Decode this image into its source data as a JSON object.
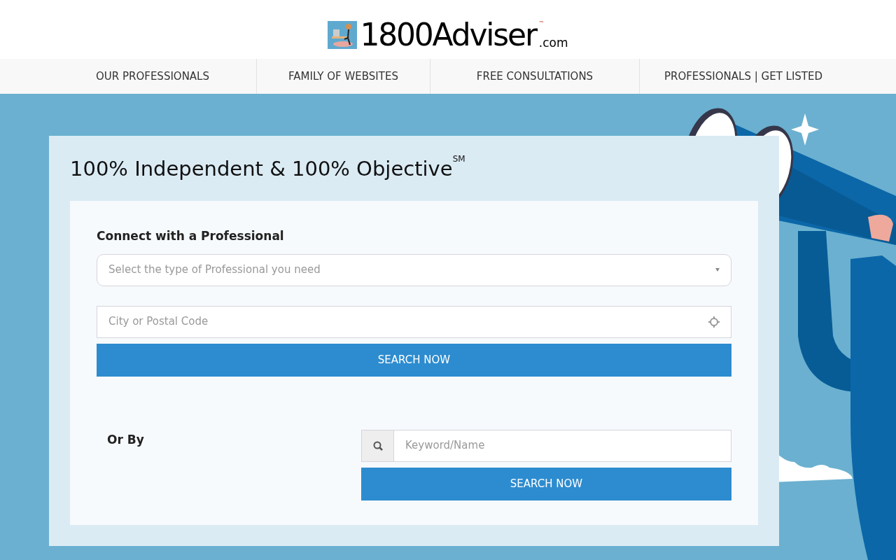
{
  "logo": {
    "name": "1800Adviser",
    "mark": "™",
    "suffix": ".com"
  },
  "nav": [
    {
      "label": "OUR PROFESSIONALS"
    },
    {
      "label": "FAMILY OF WEBSITES"
    },
    {
      "label": "FREE CONSULTATIONS"
    },
    {
      "label": "PROFESSIONALS | GET LISTED"
    }
  ],
  "hero": {
    "title": "100% Independent & 100% Objective$^{SM}$",
    "heading": "Connect with a Professional",
    "type_select": {
      "placeholder": "Select the type of Professional you need"
    },
    "location": {
      "placeholder": "City or Postal Code"
    },
    "search_button": "SEARCH NOW",
    "or_label": "Or By",
    "keyword": {
      "placeholder": "Keyword/Name"
    },
    "keyword_button": "SEARCH NOW"
  }
}
